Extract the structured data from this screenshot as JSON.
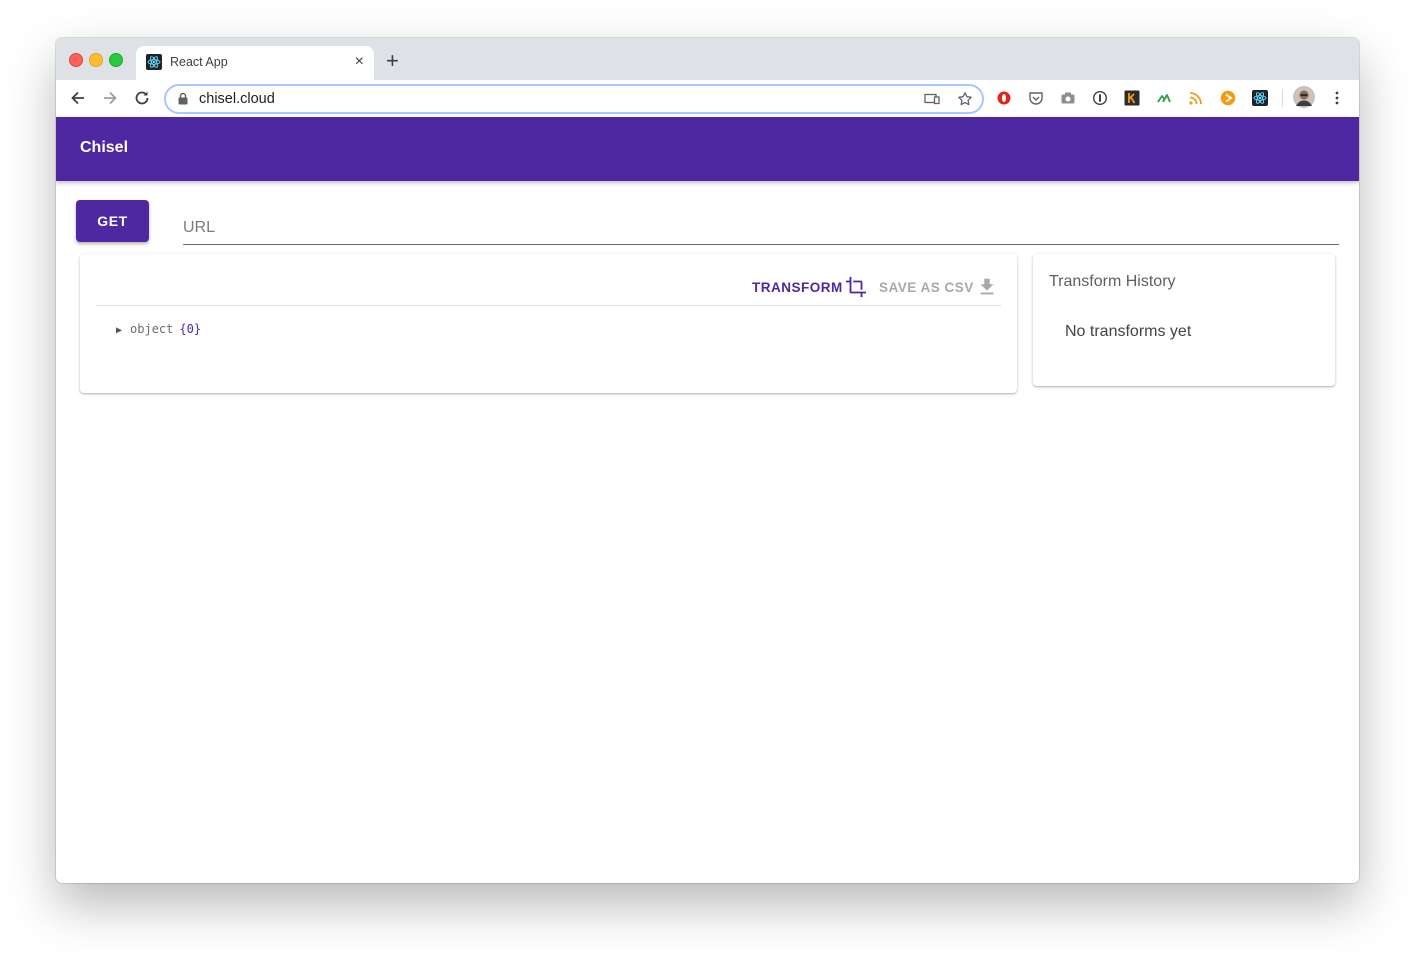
{
  "browser": {
    "tab": {
      "title": "React App",
      "close": "×"
    },
    "new_tab": "+",
    "address": "chisel.cloud",
    "icons": [
      "back-icon",
      "forward-icon",
      "reload-icon",
      "lock-icon",
      "cast-icon",
      "star-icon",
      "opera-icon",
      "pocket-icon",
      "camera-icon",
      "1password-icon",
      "k-icon",
      "green-ext-icon",
      "rss-icon",
      "play-icon",
      "react-devtools-icon",
      "avatar",
      "more-icon"
    ]
  },
  "app": {
    "brand": "Chisel",
    "get_label": "GET",
    "url_placeholder": "URL",
    "toolbar": {
      "transform_label": "TRANSFORM",
      "save_label": "SAVE AS CSV"
    },
    "tree": {
      "key": "object",
      "braces": "{0}"
    },
    "history": {
      "title": "Transform History",
      "empty": "No transforms yet"
    }
  },
  "colors": {
    "primary": "#4e28a0",
    "disabled": "#a8a8a8"
  }
}
